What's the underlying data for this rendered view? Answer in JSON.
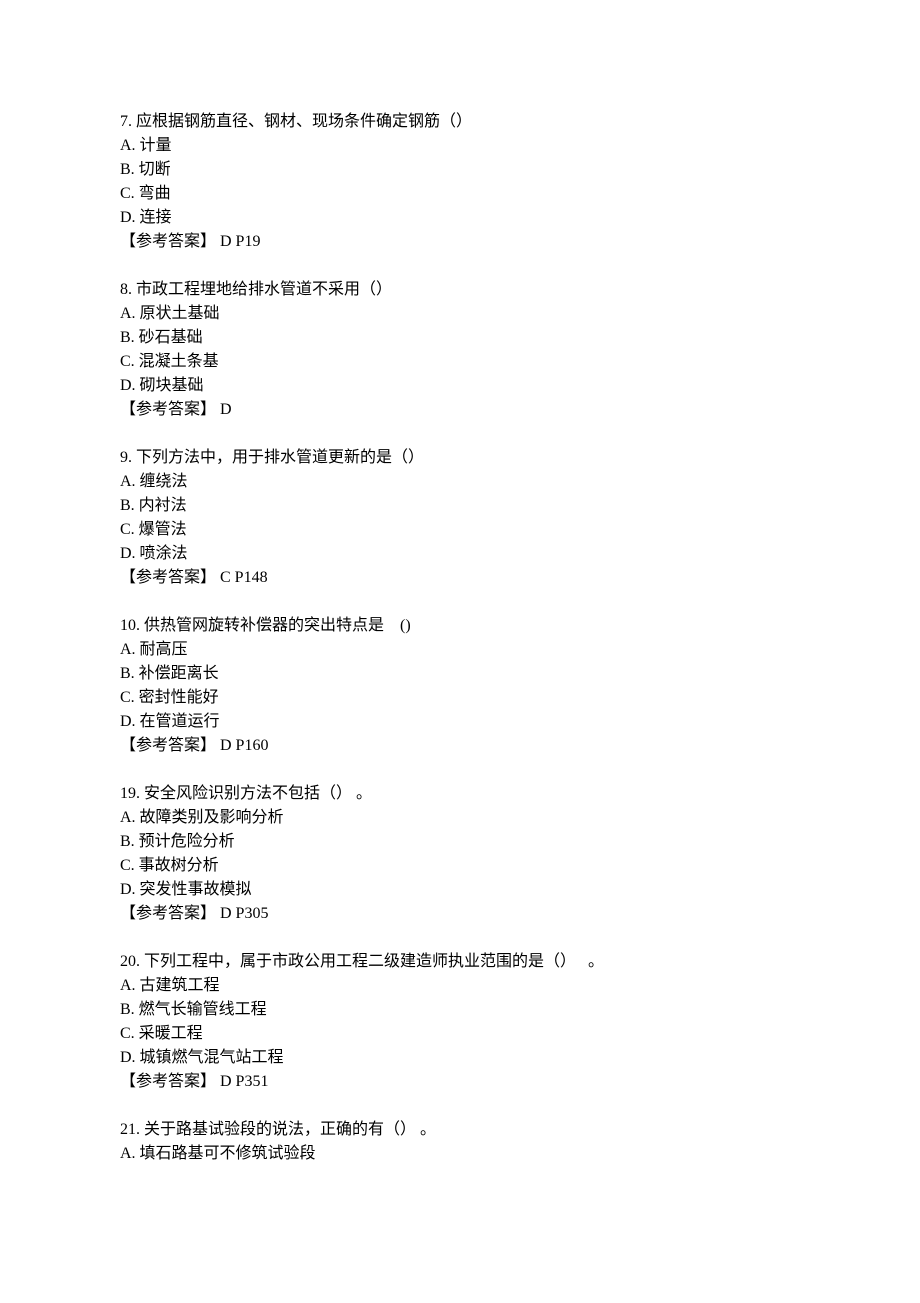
{
  "questions": [
    {
      "number": "7.",
      "stem": "应根据钢筋直径、钢材、现场条件确定钢筋（）",
      "options": [
        "A. 计量",
        "B. 切断",
        "C. 弯曲",
        "D. 连接"
      ],
      "answer": "【参考答案】 D P19"
    },
    {
      "number": "8.",
      "stem": "市政工程埋地给排水管道不采用（）",
      "options": [
        "A. 原状土基础",
        "B. 砂石基础",
        "C. 混凝土条基",
        "D. 砌块基础"
      ],
      "answer": "【参考答案】 D"
    },
    {
      "number": "9.",
      "stem": "下列方法中，用于排水管道更新的是（）",
      "options": [
        "A. 缠绕法",
        "B. 内衬法",
        "C. 爆管法",
        "D. 喷涂法"
      ],
      "answer": "【参考答案】 C P148"
    },
    {
      "number": "10.",
      "stem": "供热管网旋转补偿器的突出特点是    ()",
      "options": [
        "A. 耐高压",
        "B. 补偿距离长",
        "C. 密封性能好",
        "D. 在管道运行"
      ],
      "answer": "【参考答案】 D P160"
    },
    {
      "number": "19.",
      "stem": "安全风险识别方法不包括（） 。",
      "options": [
        "A. 故障类别及影响分析",
        "B. 预计危险分析",
        "C. 事故树分析",
        "D. 突发性事故模拟"
      ],
      "answer": "【参考答案】 D P305"
    },
    {
      "number": "20.",
      "stem": "下列工程中，属于市政公用工程二级建造师执业范围的是（）   。",
      "options": [
        "A. 古建筑工程",
        "B. 燃气长输管线工程",
        "C. 采暖工程",
        "D. 城镇燃气混气站工程"
      ],
      "answer": "【参考答案】 D P351"
    },
    {
      "number": "21.",
      "stem": "关于路基试验段的说法，正确的有（） 。",
      "options": [
        "A. 填石路基可不修筑试验段"
      ],
      "answer": null
    }
  ]
}
